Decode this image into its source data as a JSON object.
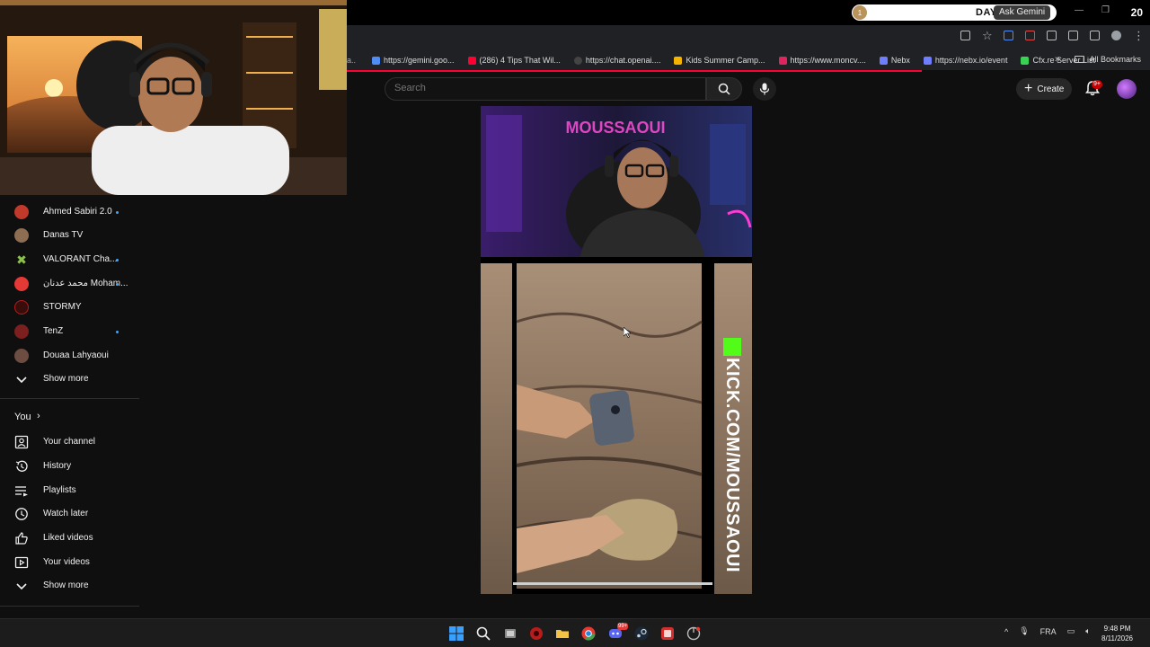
{
  "titlebar": {
    "day_label": "DAY 2",
    "gemini_label": "Ask Gemini",
    "counter": "20"
  },
  "bookmarks": [
    {
      "label": "https://gemini.goo...",
      "color": "#4f8df5"
    },
    {
      "label": "(286) 4 Tips That Wil...",
      "color": "#ff0033"
    },
    {
      "label": "https://chat.openai....",
      "color": "#444444"
    },
    {
      "label": "Kids Summer Camp...",
      "color": "#f4b400"
    },
    {
      "label": "https://www.moncv....",
      "color": "#e0245e"
    },
    {
      "label": "Nebx",
      "color": "#6f7dff"
    },
    {
      "label": "https://nebx.io/event",
      "color": "#6f7dff"
    },
    {
      "label": "Cfx.re Server List",
      "color": "#39d353"
    }
  ],
  "bookmarks_all": "All Bookmarks",
  "header": {
    "search_placeholder": "Search",
    "create_label": "Create",
    "bell_badge": "9+"
  },
  "subscriptions": [
    {
      "label": "Ahmed Sabiri 2.0",
      "live": true,
      "icon": "channel-avatar-icon",
      "color": "#c0392b"
    },
    {
      "label": "Danas TV",
      "live": false,
      "icon": "channel-avatar-icon",
      "color": "#8e6e53"
    },
    {
      "label": "VALORANT Cha...",
      "live": true,
      "icon": "valorant-icon",
      "color": "#8bc34a"
    },
    {
      "label": "محمد عدنان Moham...",
      "live": true,
      "icon": "channel-avatar-icon",
      "color": "#e53935"
    },
    {
      "label": "STORMY",
      "live": false,
      "icon": "channel-avatar-icon",
      "color": "#b71c1c"
    },
    {
      "label": "TenZ",
      "live": true,
      "icon": "channel-avatar-icon",
      "color": "#7b1f1f"
    },
    {
      "label": "Douaa Lahyaoui",
      "live": false,
      "icon": "channel-avatar-icon",
      "color": "#6d4c41"
    }
  ],
  "show_more_1": "Show more",
  "you_section": {
    "heading": "You",
    "items": [
      {
        "label": "Your channel",
        "icon": "your-channel-icon"
      },
      {
        "label": "History",
        "icon": "history-icon"
      },
      {
        "label": "Playlists",
        "icon": "playlists-icon"
      },
      {
        "label": "Watch later",
        "icon": "watch-later-icon"
      },
      {
        "label": "Liked videos",
        "icon": "liked-videos-icon"
      },
      {
        "label": "Your videos",
        "icon": "your-videos-icon"
      }
    ],
    "show_more": "Show more"
  },
  "video": {
    "overlay_text": "KICK.COM/MOUSSAOUI",
    "sign_text": "MOUSSAOUI"
  },
  "taskbar": {
    "language": "FRA",
    "time": "9:48 PM",
    "date": "8/11/2026",
    "steam_badge": "99+"
  }
}
